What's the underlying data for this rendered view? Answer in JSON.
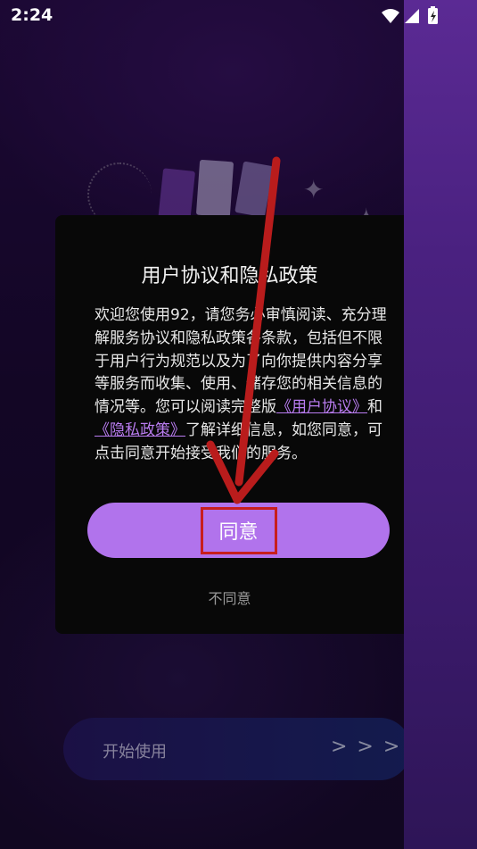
{
  "status_bar": {
    "time": "2:24",
    "icons": [
      "wifi-icon",
      "signal-icon",
      "battery-charging-icon"
    ]
  },
  "dialog": {
    "title": "用户协议和隐私政策",
    "body_part1": "欢迎您使用92，请您务必审慎阅读、充分理解服务协议和隐私政策各条款，包括但不限于用户行为规范以及为了向你提供内容分享等服务而收集、使用、储存您的相关信息的情况等。您可以阅读完整版",
    "user_agreement_link": "《用户协议》",
    "and_text": "和",
    "privacy_policy_link": "《隐私政策》",
    "body_part2": "了解详细信息，如您同意，可点击同意开始接受我们的服务。",
    "agree_label": "同意",
    "disagree_label": "不同意"
  },
  "background": {
    "start_label": "开始使用",
    "start_arrows": "> > >"
  },
  "colors": {
    "accent": "#b173ec",
    "link": "#b97cf0",
    "dialog_bg": "#080808",
    "highlight": "#c81e1e"
  }
}
